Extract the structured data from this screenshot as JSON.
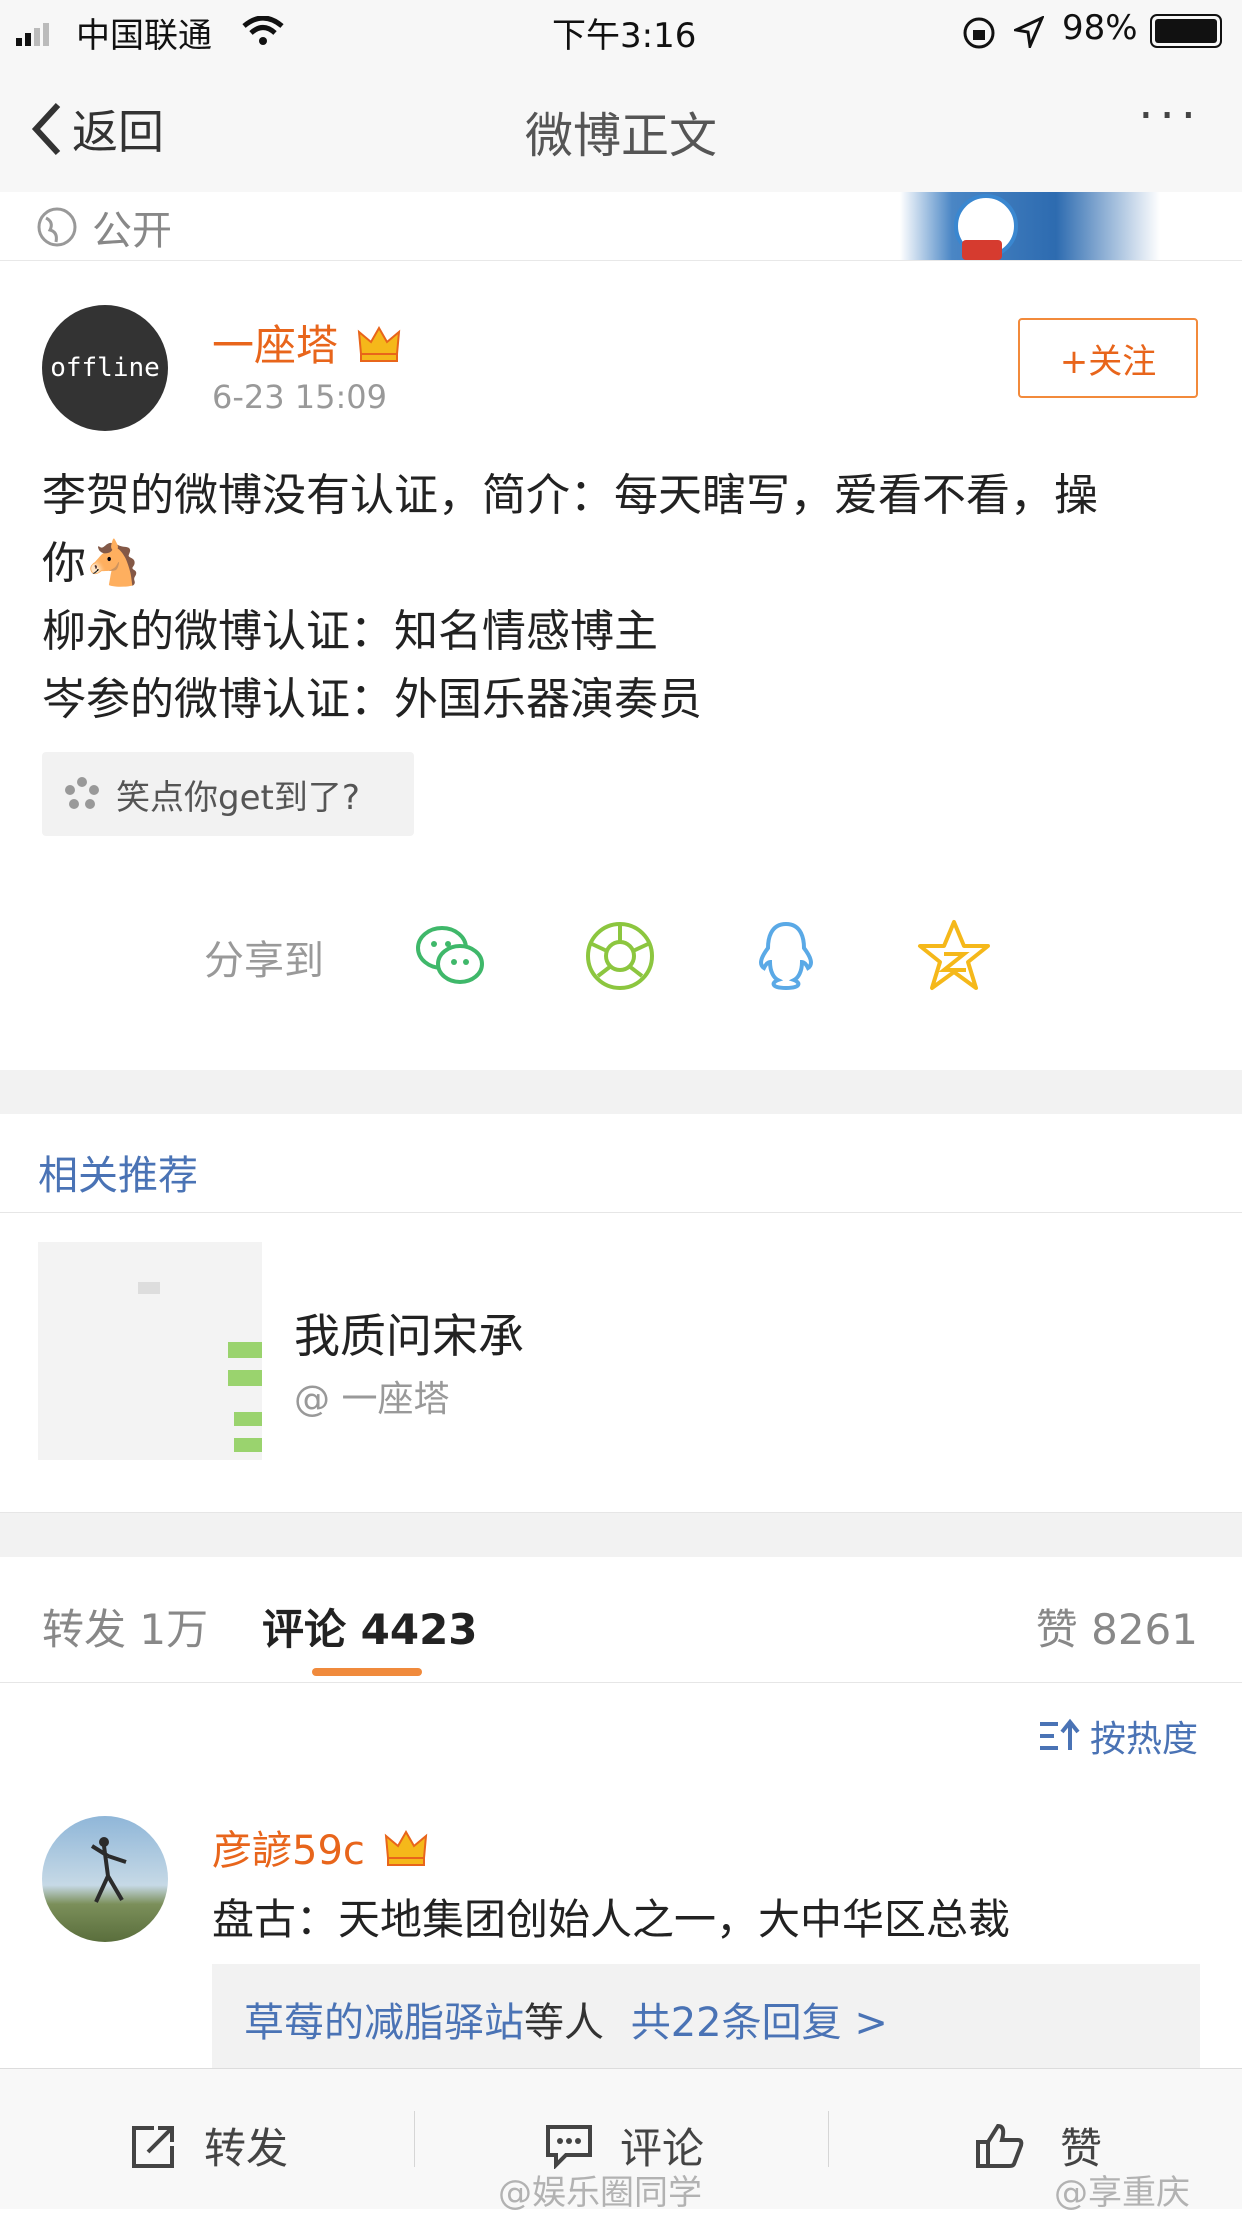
{
  "status_bar": {
    "carrier": "中国联通",
    "time": "下午3:16",
    "battery": "98%",
    "icons": [
      "signal-icon",
      "wifi-icon",
      "rotation-lock-icon",
      "location-icon",
      "battery-icon"
    ]
  },
  "nav": {
    "back_label": "返回",
    "title": "微博正文",
    "more_label": "···"
  },
  "prev_card": {
    "visibility": "公开"
  },
  "post": {
    "avatar_text": "offline",
    "author": "一座塔",
    "time": "6-23 15:09",
    "follow_label": "+关注",
    "lines": [
      "李贺的微博没有认证，简介：每天瞎写，爱看不看，操",
      "你🐴",
      "柳永的微博认证：知名情感博主",
      "岑参的微博认证：外国乐器演奏员"
    ],
    "topic": "笑点你get到了?",
    "share_label": "分享到"
  },
  "related": {
    "header": "相关推荐",
    "title": "我质问宋承",
    "author": "@ 一座塔"
  },
  "tabs": {
    "reposts": "转发 1万",
    "comments": "评论 4423",
    "likes": "赞 8261",
    "sort": "按热度"
  },
  "comment": {
    "author": "彦諺59c",
    "text": "盘古：天地集团创始人之一，大中华区总裁",
    "replies_name": "草莓的减脂驿站",
    "replies_mid": "等人",
    "replies_count": "共22条回复 >"
  },
  "bottom_bar": {
    "repost": "转发",
    "comment": "评论",
    "like": "赞",
    "watermark1": "@娱乐圈同学",
    "watermark2": "@享重庆"
  },
  "colors": {
    "accent_orange": "#e8651b",
    "link_blue": "#4a73b5",
    "wechat_green": "#3fb86a",
    "moments_green": "#8cc63f",
    "qq_blue": "#5aa9e6",
    "qzone_yellow": "#f5b81a"
  }
}
